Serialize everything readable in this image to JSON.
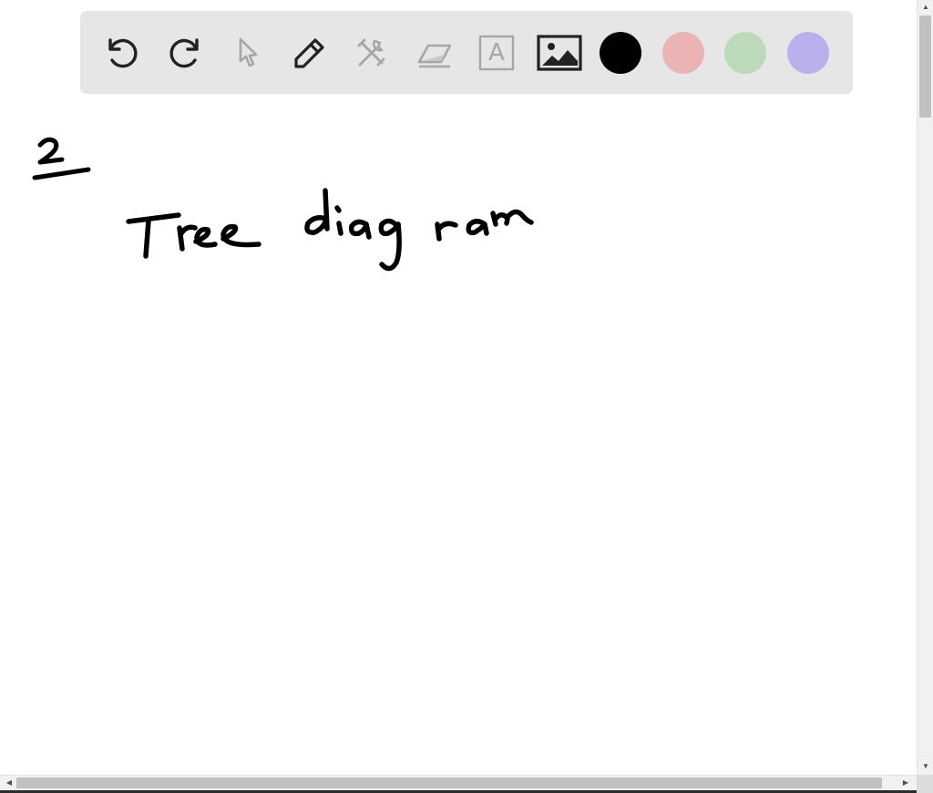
{
  "toolbar": {
    "tools": [
      {
        "name": "undo-icon",
        "enabled": true
      },
      {
        "name": "redo-icon",
        "enabled": true
      },
      {
        "name": "pointer-icon",
        "enabled": false
      },
      {
        "name": "pen-icon",
        "enabled": true
      },
      {
        "name": "tools-icon",
        "enabled": false
      },
      {
        "name": "eraser-icon",
        "enabled": false
      },
      {
        "name": "text-icon",
        "enabled": false
      },
      {
        "name": "image-icon",
        "enabled": true
      }
    ],
    "text_tool_glyph": "A",
    "colors": [
      {
        "name": "black",
        "hex": "#000000",
        "selected": true
      },
      {
        "name": "pink",
        "hex": "#ebb3b3"
      },
      {
        "name": "green",
        "hex": "#bcd9b9"
      },
      {
        "name": "purple",
        "hex": "#b9b1ec"
      }
    ]
  },
  "canvas": {
    "handwriting": [
      "2",
      "Tree diagram"
    ],
    "ink_color": "#000000"
  },
  "scrollbars": {
    "vertical": {
      "position": 0.0
    },
    "horizontal": {
      "position": 0.0
    }
  }
}
